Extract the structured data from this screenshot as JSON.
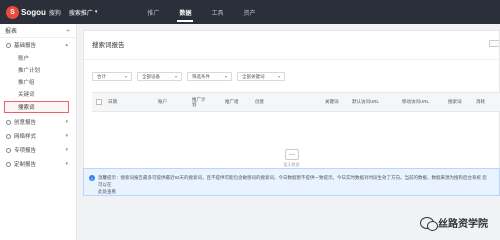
{
  "header": {
    "logo_mark": "S",
    "logo_text": "Sogou",
    "logo_sub": "搜狗",
    "product": "搜索推广",
    "nav": [
      "推广",
      "数据",
      "工具",
      "资产"
    ],
    "active_nav": "数据"
  },
  "sidebar": {
    "title": "报表",
    "groups": [
      {
        "label": "基础报告",
        "expanded": true,
        "items": [
          "账户",
          "推广计划",
          "推广组",
          "关键词",
          "搜索词"
        ]
      },
      {
        "label": "创意报告"
      },
      {
        "label": "网络样式"
      },
      {
        "label": "专项报告"
      },
      {
        "label": "定制报告"
      }
    ],
    "active_item": "搜索词"
  },
  "report": {
    "title": "搜索词报告",
    "filters": [
      "合计",
      "全部设备",
      "筛选条件",
      "全部关键词"
    ],
    "columns": [
      "日期",
      "账户",
      "推广计划",
      "推广组",
      "创意",
      "关键词",
      "默认访问URL",
      "移动访问URL",
      "搜索词",
      "消耗"
    ],
    "empty_text": "暂无数据",
    "notice": "温馨提示：搜索词报告最多可提供最近92天的搜索词，且不提供可能包含敏感词的搜索词。今日数据暂不提供，最近12个月可提供下载，自提交之日起保留7天，请及时下载。数据来源为搜狗后台系统。",
    "notice_line1": "温馨提示：搜索词报告最多可提供最近92天的搜索词，且不提供可能包含敏感词的搜索词。今日数据暂不提供一致提示。今日实时数据对时段生效了方向。当前的数据，数据来源为搜狗后台系统 您可以在",
    "notice_line2": "此处查看"
  },
  "watermark": {
    "text": "丝路资学院"
  },
  "colors": {
    "topbar": "#2b2f3a",
    "active_border": "#e8626e",
    "notice_bg": "#e8f3ff",
    "info_icon": "#2f86eb"
  }
}
